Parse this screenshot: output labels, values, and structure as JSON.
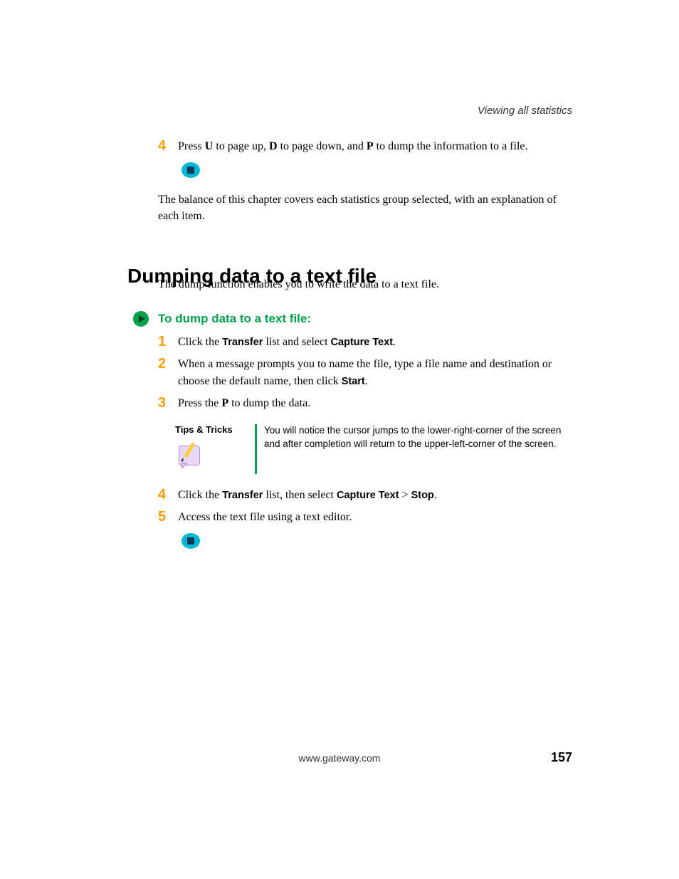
{
  "header": {
    "section": "Viewing all statistics"
  },
  "top": {
    "step4": {
      "num": "4",
      "pre": "Press ",
      "k1": "U",
      "mid1": " to page up, ",
      "k2": "D",
      "mid2": " to page down, and ",
      "k3": "P",
      "post": " to dump the information to a file."
    },
    "para": "The balance of this chapter covers each statistics group selected, with an explanation of each item."
  },
  "h2": "Dumping data to a text file",
  "intro": "The dump function enables you to write the data to a text file.",
  "subhead": "To dump data to a text file:",
  "steps": {
    "s1": {
      "num": "1",
      "pre": "Click the ",
      "b1": "Transfer",
      "mid": " list and select ",
      "b2": "Capture Text",
      "post": "."
    },
    "s2": {
      "num": "2",
      "pre": "When a message prompts you to name the file, type a file name and destination or choose the default name, then click ",
      "b1": "Start",
      "post": "."
    },
    "s3": {
      "num": "3",
      "pre": "Press the ",
      "b1": "P",
      "post": " to dump the data."
    },
    "s4": {
      "num": "4",
      "pre": "Click the ",
      "b1": "Transfer",
      "mid1": " list, then select ",
      "b2": "Capture Text",
      "gt": " > ",
      "b3": "Stop",
      "post": "."
    },
    "s5": {
      "num": "5",
      "text": "Access the text file using a text editor."
    }
  },
  "tips": {
    "label": "Tips & Tricks",
    "text": "You will notice the cursor jumps to the lower-right-corner of the screen and after completion will return to the upper-left-corner of the screen."
  },
  "footer": {
    "url": "www.gateway.com",
    "page": "157"
  }
}
